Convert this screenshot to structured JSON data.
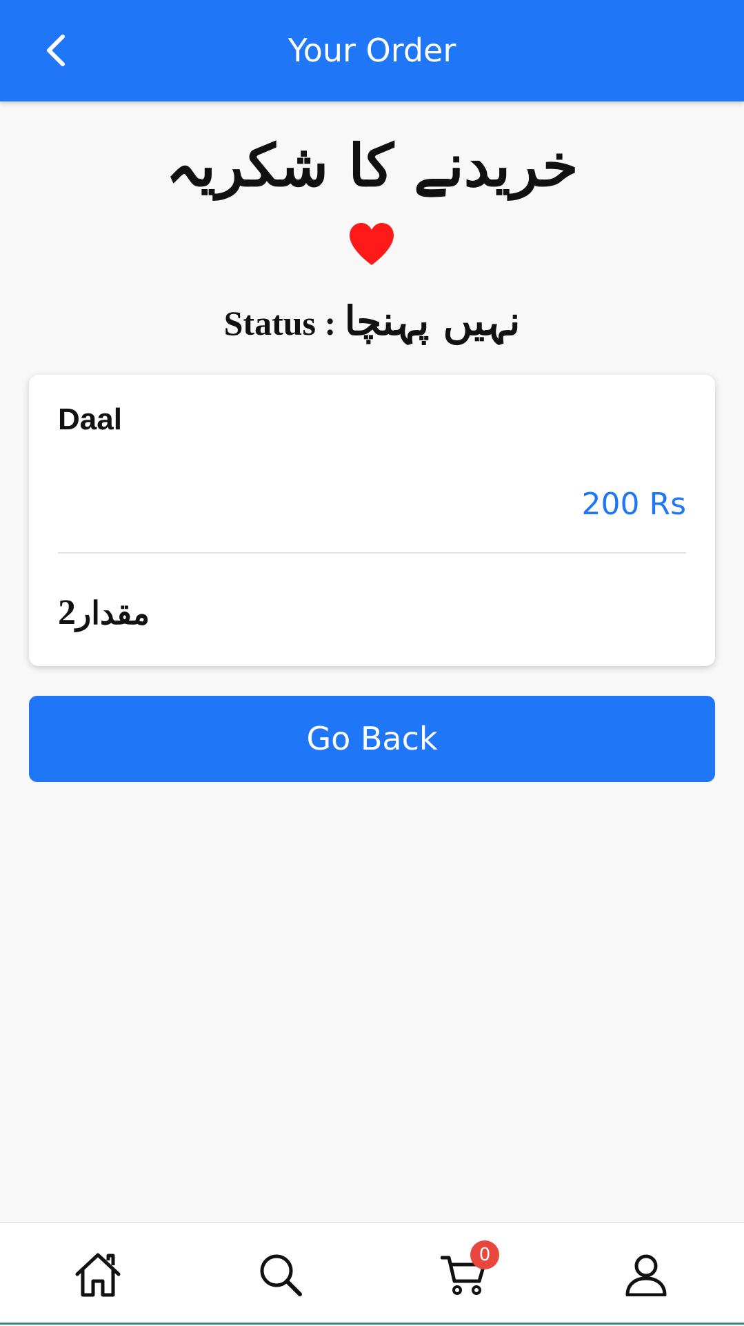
{
  "header": {
    "title": "Your Order",
    "back_icon": "chevron-left-icon",
    "background": "#1f76f6"
  },
  "thanks_message": "خریدنے کا شکریہ",
  "heart_icon": "heart-icon",
  "status": {
    "label": "Status :",
    "value": "نہیں پہنچا"
  },
  "order_item": {
    "name": "Daal",
    "price": "200 Rs",
    "quantity_label": "مقدار",
    "quantity_value": "2"
  },
  "go_back_label": "Go Back",
  "bottom_nav": {
    "items": [
      {
        "icon": "home-icon"
      },
      {
        "icon": "search-icon"
      },
      {
        "icon": "cart-icon",
        "badge": "0"
      },
      {
        "icon": "user-icon"
      }
    ]
  },
  "colors": {
    "accent": "#1f76f6",
    "heart": "#ff1a1a",
    "badge": "#e8473d"
  }
}
